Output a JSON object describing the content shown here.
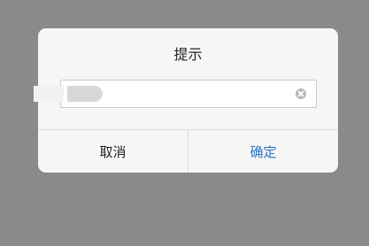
{
  "dialog": {
    "title": "提示",
    "input": {
      "value": "",
      "placeholder": ""
    },
    "clear_icon": "clear-circle-icon",
    "buttons": {
      "cancel_label": "取消",
      "ok_label": "确定"
    }
  },
  "colors": {
    "backdrop": "#8a8a8a",
    "dialog_bg": "#f6f6f4",
    "ok_text": "#2e74c8",
    "cancel_text": "#222222",
    "divider": "#dcdcdc"
  }
}
